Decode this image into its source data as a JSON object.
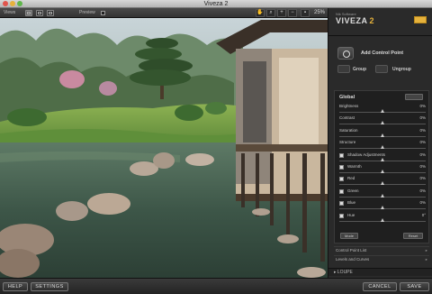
{
  "window": {
    "title": "Viveza 2"
  },
  "toolbar": {
    "views_label": "Views",
    "preview_label": "Preview",
    "zoom_value": "25%"
  },
  "panel": {
    "brand_top": "Nik Software",
    "brand_name": "VIVEZA",
    "brand_version": "2",
    "add_control_point": "Add Control Point",
    "group_label": "Group",
    "ungroup_label": "Ungroup",
    "global_title": "Global",
    "adjustments": [
      {
        "label": "Brightness",
        "value": "0%",
        "checkbox": false
      },
      {
        "label": "Contrast",
        "value": "0%",
        "checkbox": false
      },
      {
        "label": "Saturation",
        "value": "0%",
        "checkbox": false
      },
      {
        "label": "Structure",
        "value": "0%",
        "checkbox": false
      },
      {
        "label": "Shadow Adjustments",
        "value": "0%",
        "checkbox": true
      },
      {
        "label": "Warmth",
        "value": "0%",
        "checkbox": true
      },
      {
        "label": "Red",
        "value": "0%",
        "checkbox": true
      },
      {
        "label": "Green",
        "value": "0%",
        "checkbox": true
      },
      {
        "label": "Blue",
        "value": "0%",
        "checkbox": true
      },
      {
        "label": "Hue",
        "value": "0°",
        "checkbox": true
      }
    ],
    "mode_label": "Mode",
    "reset_label": "Reset",
    "control_point_list": "Control Point List",
    "levels_and_curves": "Levels and Curves",
    "loupe": "LOUPE"
  },
  "bottom": {
    "help": "HELP",
    "settings": "SETTINGS",
    "cancel": "CANCEL",
    "save": "SAVE"
  },
  "colors": {
    "accent": "#e6b23c",
    "panel_bg": "#2a2a2a"
  }
}
